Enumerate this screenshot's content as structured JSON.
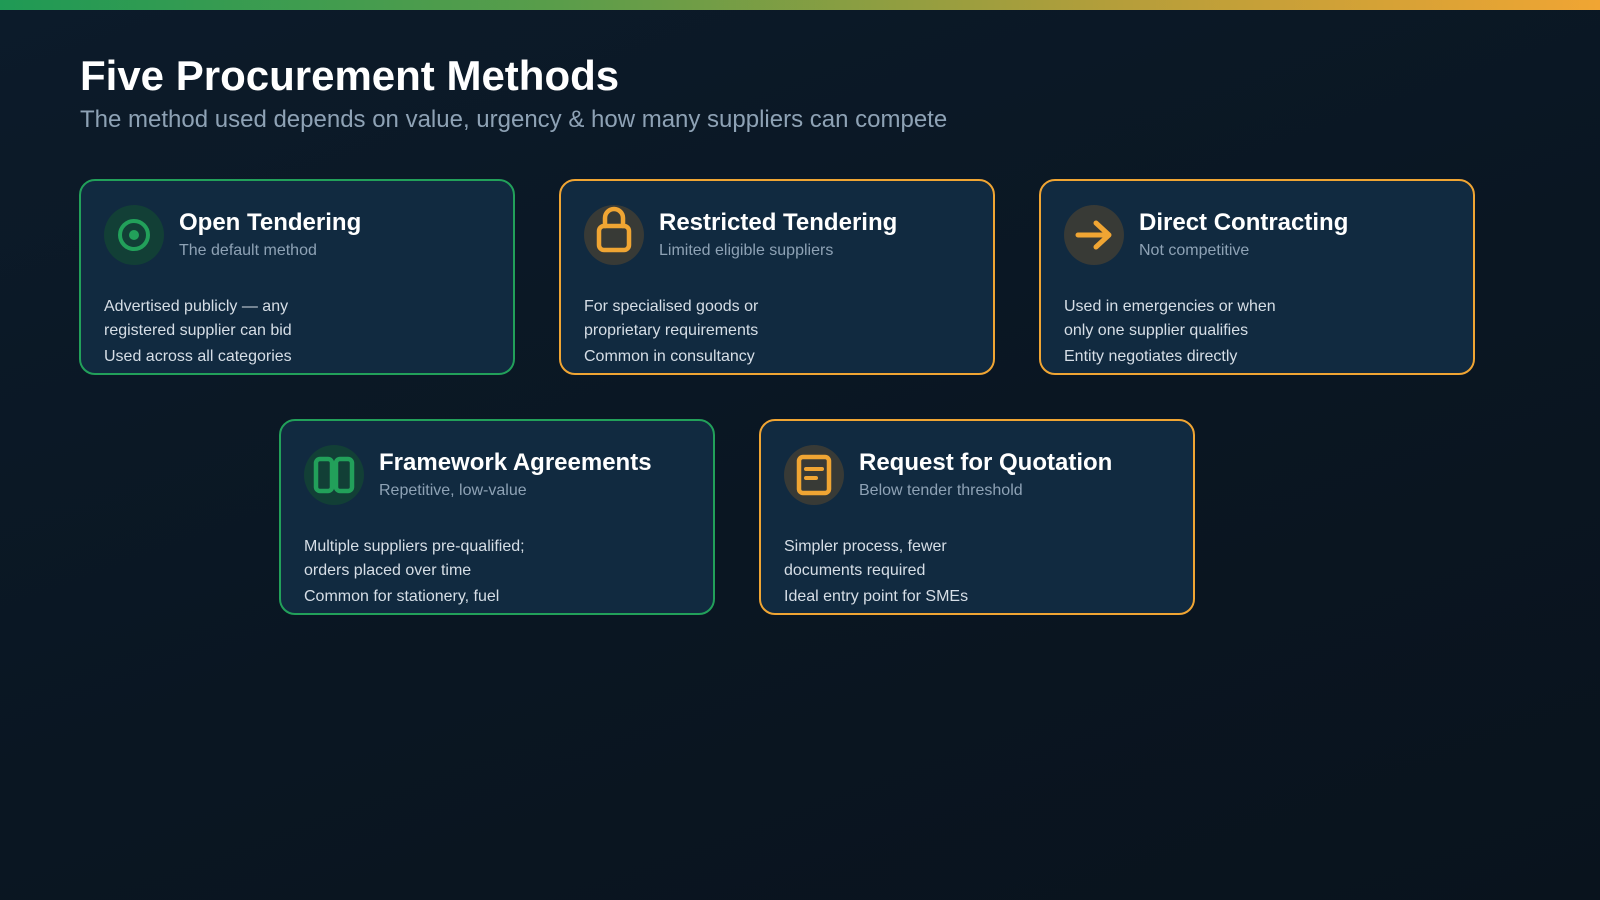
{
  "header": {
    "title": "Five Procurement Methods",
    "subtitle": "The method used depends on value, urgency & how many suppliers can compete"
  },
  "colors": {
    "green": "#22a05a",
    "orange": "#f0a533",
    "card_bg": "#112a40",
    "page_bg": "#0a1622",
    "muted_text": "#8ea2b5"
  },
  "cards": [
    {
      "icon": "target-icon",
      "accent": "green",
      "title": "Open Tendering",
      "subtitle": "The default method",
      "lines": [
        "Advertised publicly — any",
        "registered supplier can bid",
        "Used across all categories"
      ]
    },
    {
      "icon": "lock-icon",
      "accent": "orange",
      "title": "Restricted Tendering",
      "subtitle": "Limited eligible suppliers",
      "lines": [
        "For specialised goods or",
        "proprietary requirements",
        "Common in consultancy"
      ]
    },
    {
      "icon": "arrow-right-icon",
      "accent": "orange",
      "title": "Direct Contracting",
      "subtitle": "Not competitive",
      "lines": [
        "Used in emergencies or when",
        "only one supplier qualifies",
        "Entity negotiates directly"
      ]
    },
    {
      "icon": "columns-icon",
      "accent": "green",
      "title": "Framework Agreements",
      "subtitle": "Repetitive, low-value",
      "lines": [
        "Multiple suppliers pre-qualified;",
        "orders placed over time",
        "Common for stationery, fuel"
      ]
    },
    {
      "icon": "document-icon",
      "accent": "orange",
      "title": "Request for Quotation",
      "subtitle": "Below tender threshold",
      "lines": [
        "Simpler process, fewer",
        "documents required",
        "Ideal entry point for SMEs"
      ]
    }
  ]
}
